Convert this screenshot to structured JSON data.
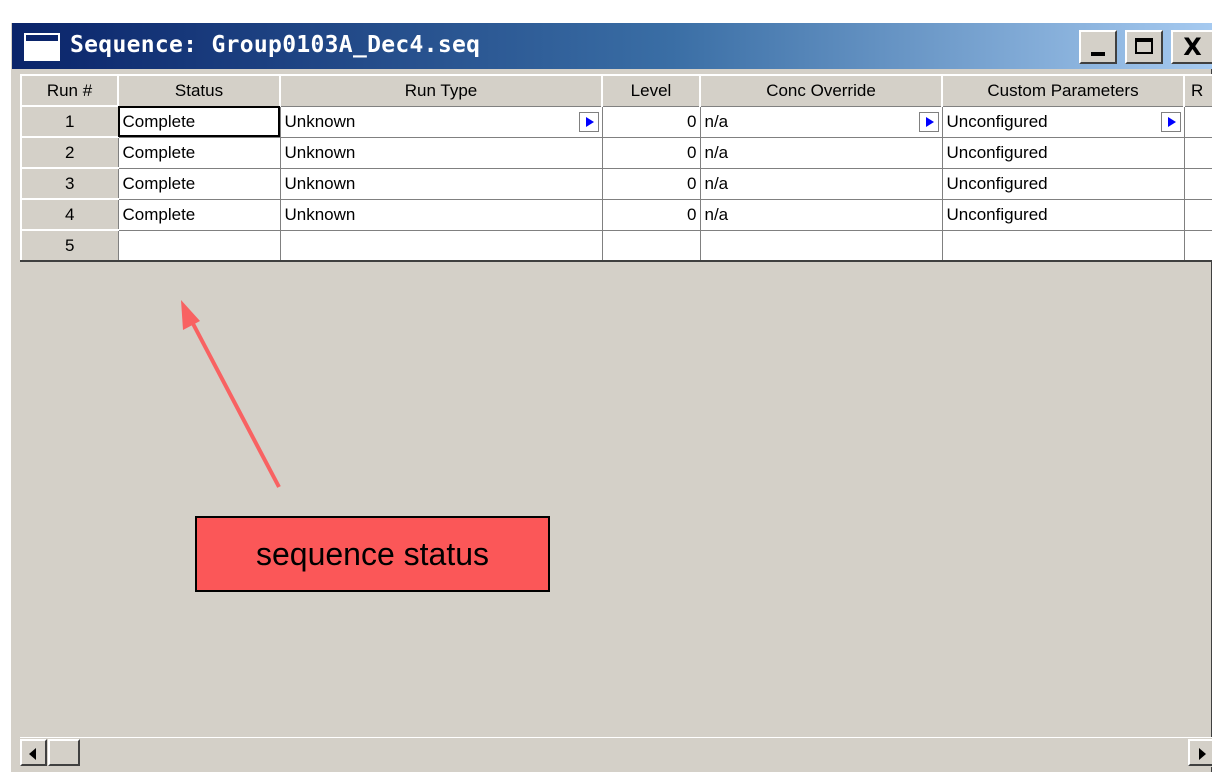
{
  "window": {
    "title": "Sequence: Group0103A_Dec4.seq",
    "controls": {
      "minimize": "_",
      "maximize": "□",
      "close": "X"
    }
  },
  "grid": {
    "columns": [
      "Run #",
      "Status",
      "Run Type",
      "Level",
      "Conc Override",
      "Custom Parameters",
      "R"
    ],
    "rows": [
      {
        "run": "1",
        "status": "Complete",
        "run_type": "Unknown",
        "level": "0",
        "conc_override": "n/a",
        "custom_parameters": "Unconfigured"
      },
      {
        "run": "2",
        "status": "Complete",
        "run_type": "Unknown",
        "level": "0",
        "conc_override": "n/a",
        "custom_parameters": "Unconfigured"
      },
      {
        "run": "3",
        "status": "Complete",
        "run_type": "Unknown",
        "level": "0",
        "conc_override": "n/a",
        "custom_parameters": "Unconfigured"
      },
      {
        "run": "4",
        "status": "Complete",
        "run_type": "Unknown",
        "level": "0",
        "conc_override": "n/a",
        "custom_parameters": "Unconfigured"
      },
      {
        "run": "5",
        "status": "",
        "run_type": "",
        "level": "",
        "conc_override": "",
        "custom_parameters": ""
      }
    ]
  },
  "annotation": {
    "label": "sequence status",
    "color": "#fb5758"
  },
  "colors": {
    "title_start": "#0a246a",
    "title_end": "#a6caf0",
    "face": "#d4d0c8",
    "dropdown_arrow": "#0000ff"
  }
}
